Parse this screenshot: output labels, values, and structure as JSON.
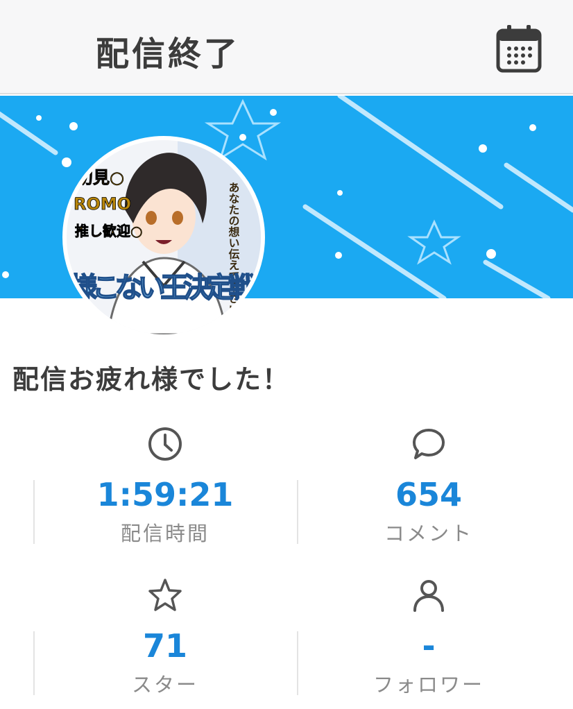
{
  "header": {
    "title": "配信終了",
    "calendar_icon": "calendar-icon"
  },
  "avatar": {
    "title_line": "様こない王決定戦",
    "badge_lines": [
      "初見○",
      "ROMO",
      "推し歓迎○"
    ],
    "vertical_text": "あなたの想い伝えて下さい"
  },
  "message": "配信お疲れ様でした！",
  "stats": [
    {
      "icon": "clock-icon",
      "value": "1:59:21",
      "label": "配信時間"
    },
    {
      "icon": "comment-icon",
      "value": "654",
      "label": "コメント"
    },
    {
      "icon": "star-icon",
      "value": "71",
      "label": "スター"
    },
    {
      "icon": "user-icon",
      "value": "-",
      "label": "フォロワー"
    }
  ],
  "colors": {
    "banner": "#1ba9f2",
    "accent": "#1a86d9",
    "header_bg": "#f7f7f8"
  }
}
